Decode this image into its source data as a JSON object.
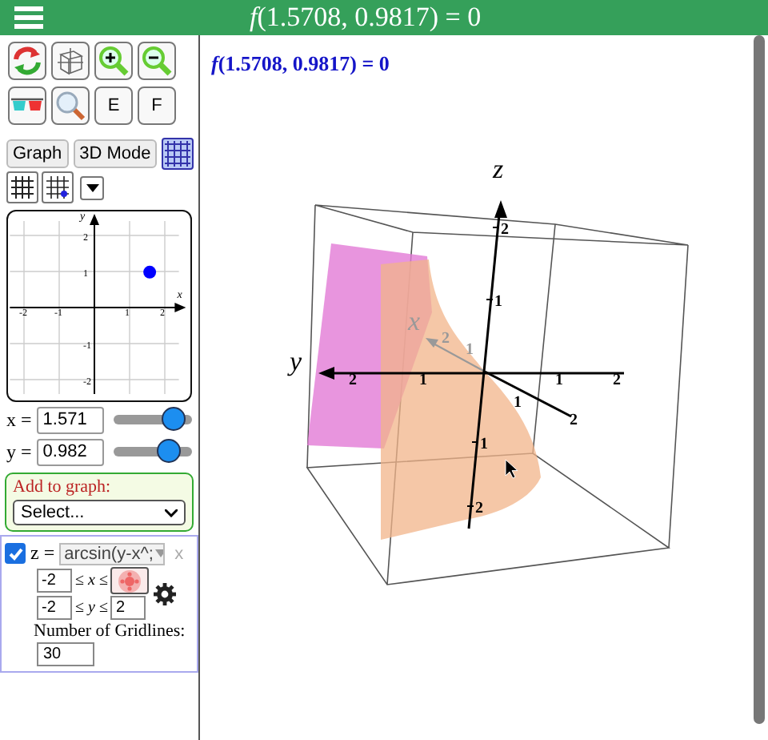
{
  "menu_bar": {
    "title": "*f*(1.5708, 0.9817) = 0"
  },
  "toolbar": [
    {
      "kind": "rotate"
    },
    {
      "kind": "cube"
    },
    {
      "kind": "zoom_in"
    },
    {
      "kind": "zoom_out"
    },
    {
      "kind": "glasses"
    },
    {
      "kind": "magnifier"
    },
    {
      "kind": "text",
      "label": "E"
    },
    {
      "kind": "text",
      "label": "F"
    }
  ],
  "mode_buttons": [
    {
      "label": "Graph"
    },
    {
      "label": "3D Mode"
    }
  ],
  "mini_graph": {
    "x_ticks": [
      "-2",
      "-1",
      "1",
      "2"
    ],
    "y_ticks": [
      "2",
      "1",
      "-1",
      "-2"
    ],
    "x_label": "x",
    "y_label": "y"
  },
  "variables": [
    {
      "label": "x =",
      "value": "1.571",
      "level": 0.9
    },
    {
      "label": "y =",
      "value": "0.982",
      "level": 0.82
    }
  ],
  "add_to_graph": {
    "label": "Add to graph:",
    "value": "Select..."
  },
  "function": {
    "checked": true,
    "lhs": "z =",
    "expression": "arcsin(y-x^;",
    "remove": "x",
    "bounds": [
      {
        "min": "-2",
        "relation": "≤ *x* ≤"
      },
      {
        "min": "-2",
        "relation": "≤ *y* ≤",
        "max": "2"
      }
    ],
    "gridlines_label": "Number of Gridlines:",
    "gridlines": "30"
  },
  "canvas": {
    "readout": "*f*(1.5708, 0.9817) = 0",
    "axis_labels": [
      "z",
      "y",
      "x"
    ],
    "z_ticks": [
      "2",
      "1",
      "1",
      "2"
    ],
    "y_ticks": [
      "2",
      "1",
      "1",
      "2"
    ],
    "x_ticks": [
      "1",
      "2"
    ],
    "x_back_ticks": [
      "1",
      "2"
    ]
  }
}
